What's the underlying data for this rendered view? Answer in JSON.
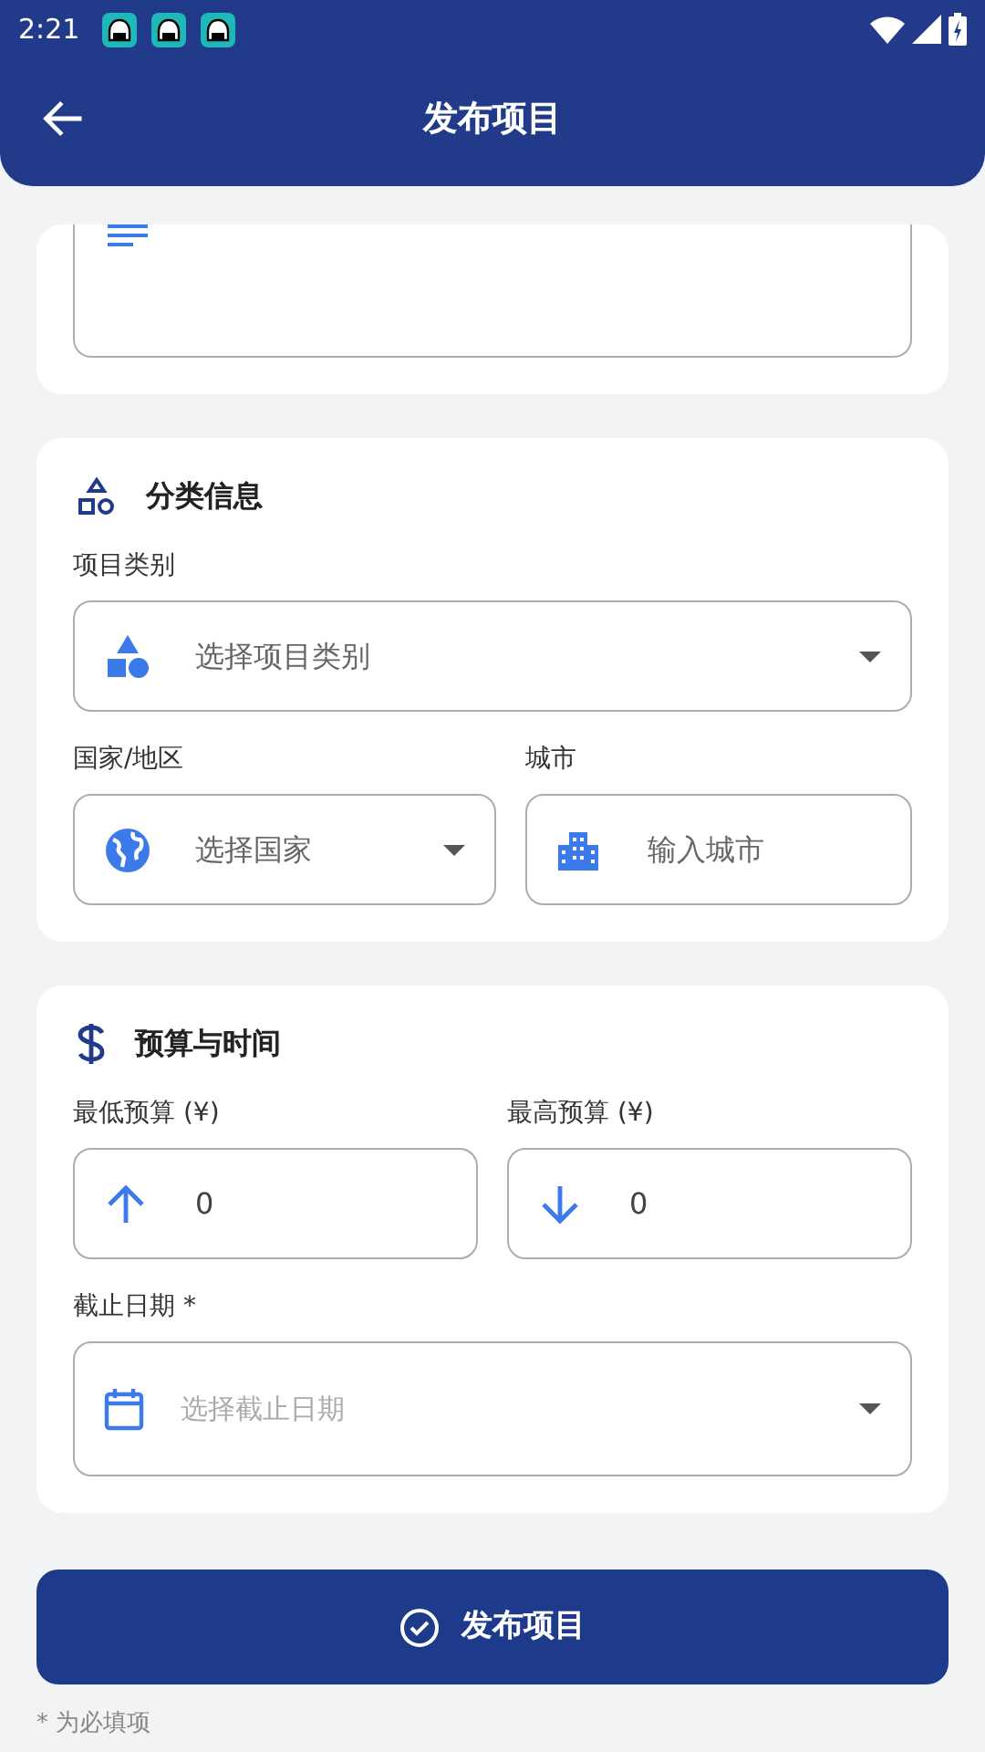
{
  "status_bar": {
    "time": "2:21",
    "notifications": [
      {
        "kind": "app"
      },
      {
        "kind": "app"
      },
      {
        "kind": "app"
      }
    ]
  },
  "app_bar": {
    "title": "发布项目"
  },
  "partial_card": {
    "kind": "textarea"
  },
  "sections": [
    {
      "title": "分类信息",
      "rows": [
        [
          {
            "kind": "select",
            "label": "项目类别",
            "placeholder": "选择项目类别"
          }
        ],
        [
          {
            "kind": "select",
            "label": "国家/地区",
            "placeholder": "选择国家"
          },
          {
            "kind": "input",
            "label": "城市",
            "placeholder": "输入城市"
          }
        ]
      ]
    },
    {
      "title": "预算与时间",
      "rows": [
        [
          {
            "kind": "input",
            "label": "最低预算 (¥)",
            "value": "0"
          },
          {
            "kind": "input",
            "label": "最高预算 (¥)",
            "value": "0"
          }
        ],
        [
          {
            "kind": "date",
            "label": "截止日期 *",
            "placeholder": "选择截止日期"
          }
        ]
      ]
    }
  ],
  "submit_button": {
    "label": "发布项目"
  },
  "footnote": "* 为必填项"
}
